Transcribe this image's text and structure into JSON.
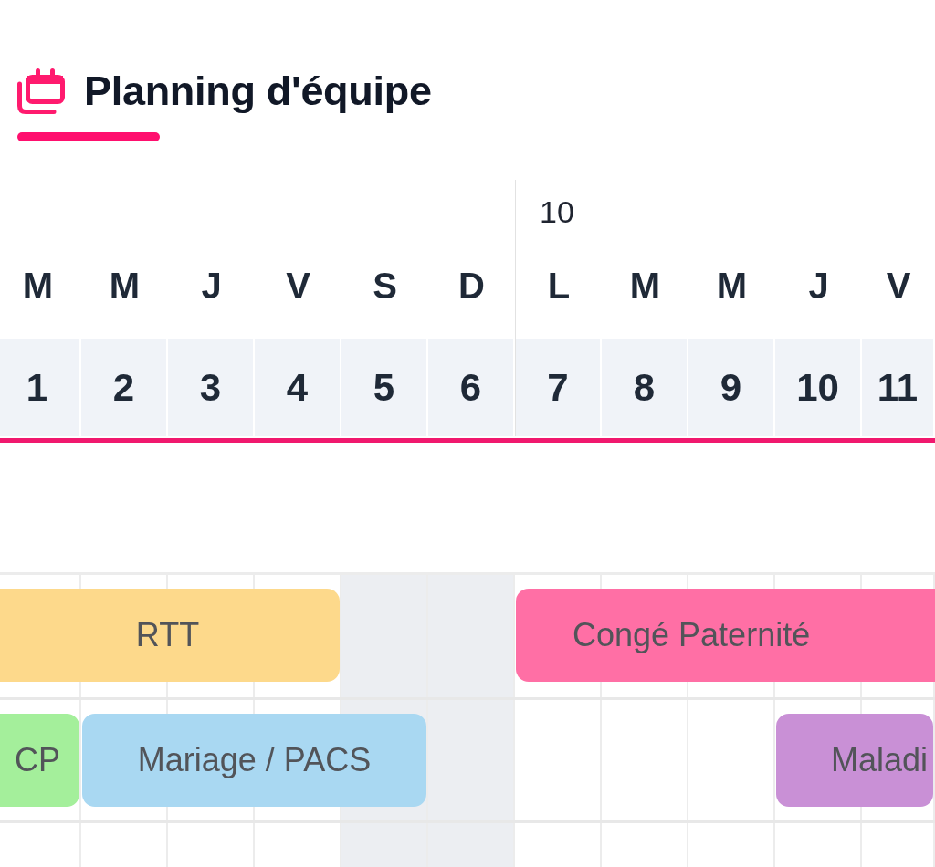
{
  "header": {
    "title": "Planning d'équipe"
  },
  "calendar": {
    "days": [
      {
        "weekday": "M",
        "date": "1",
        "weekend": false
      },
      {
        "weekday": "M",
        "date": "2",
        "weekend": false
      },
      {
        "weekday": "J",
        "date": "3",
        "weekend": false
      },
      {
        "weekday": "V",
        "date": "4",
        "weekend": false
      },
      {
        "weekday": "S",
        "date": "5",
        "weekend": true
      },
      {
        "weekday": "D",
        "date": "6",
        "weekend": true
      },
      {
        "weekday": "L",
        "date": "7",
        "weekend": false,
        "week": "10"
      },
      {
        "weekday": "M",
        "date": "8",
        "weekend": false
      },
      {
        "weekday": "M",
        "date": "9",
        "weekend": false
      },
      {
        "weekday": "J",
        "date": "10",
        "weekend": false
      },
      {
        "weekday": "V",
        "date": "11",
        "weekend": false
      }
    ],
    "rows": [
      {
        "events": [
          {
            "label": "RTT",
            "color": "#fdd98b"
          },
          {
            "label": "Congé Paternité",
            "color": "#ff6fa5"
          }
        ]
      },
      {
        "events": [
          {
            "label": "CP",
            "color": "#a4ef9b"
          },
          {
            "label": "Mariage / PACS",
            "color": "#a9d8f2"
          },
          {
            "label": "Maladi",
            "color": "#c990d6"
          }
        ]
      }
    ]
  }
}
